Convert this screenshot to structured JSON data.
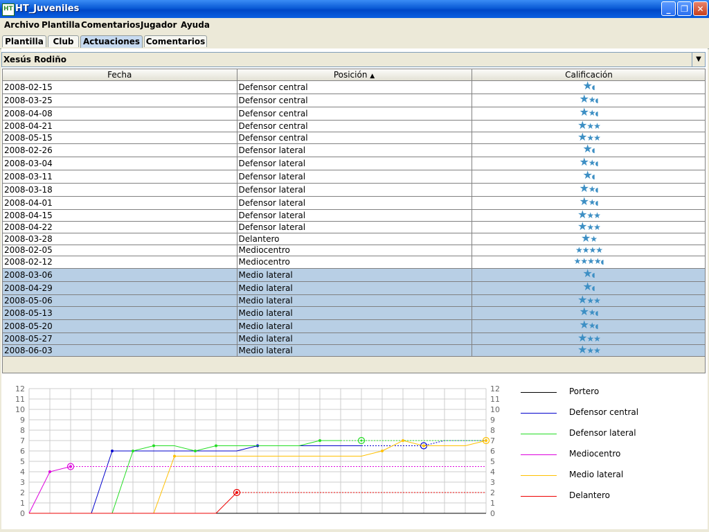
{
  "window": {
    "title": "HT_Juveniles",
    "icon_label": "HT"
  },
  "menu": [
    "Archivo",
    "Plantilla",
    "Comentarios",
    "Jugador",
    "Ayuda"
  ],
  "tabs": [
    {
      "label": "Plantilla",
      "active": false
    },
    {
      "label": "Club",
      "active": false
    },
    {
      "label": "Actuaciones",
      "active": true
    },
    {
      "label": "Comentarios",
      "active": false
    }
  ],
  "player_select": {
    "value": "Xesús Rodiño"
  },
  "table": {
    "columns": [
      "Fecha",
      "Posición",
      "Calificación"
    ],
    "sort_indicator": "▲",
    "rows": [
      {
        "fecha": "2008-02-15",
        "posicion": "Defensor central",
        "stars": "1.5",
        "selected": false
      },
      {
        "fecha": "2008-03-25",
        "posicion": "Defensor central",
        "stars": "2.5",
        "selected": false
      },
      {
        "fecha": "2008-04-08",
        "posicion": "Defensor central",
        "stars": "2.5",
        "selected": false
      },
      {
        "fecha": "2008-04-21",
        "posicion": "Defensor central",
        "stars": "3",
        "selected": false
      },
      {
        "fecha": "2008-05-15",
        "posicion": "Defensor central",
        "stars": "3",
        "selected": false
      },
      {
        "fecha": "2008-02-26",
        "posicion": "Defensor lateral",
        "stars": "1.5",
        "selected": false
      },
      {
        "fecha": "2008-03-04",
        "posicion": "Defensor lateral",
        "stars": "2.5",
        "selected": false
      },
      {
        "fecha": "2008-03-11",
        "posicion": "Defensor lateral",
        "stars": "1.5",
        "selected": false
      },
      {
        "fecha": "2008-03-18",
        "posicion": "Defensor lateral",
        "stars": "2.5",
        "selected": false
      },
      {
        "fecha": "2008-04-01",
        "posicion": "Defensor lateral",
        "stars": "2.5",
        "selected": false
      },
      {
        "fecha": "2008-04-15",
        "posicion": "Defensor lateral",
        "stars": "3",
        "selected": false
      },
      {
        "fecha": "2008-04-22",
        "posicion": "Defensor lateral",
        "stars": "3",
        "selected": false
      },
      {
        "fecha": "2008-03-28",
        "posicion": "Delantero",
        "stars": "2",
        "selected": false
      },
      {
        "fecha": "2008-02-05",
        "posicion": "Mediocentro",
        "stars": "4",
        "selected": false
      },
      {
        "fecha": "2008-02-12",
        "posicion": "Mediocentro",
        "stars": "4.5",
        "selected": false
      },
      {
        "fecha": "2008-03-06",
        "posicion": "Medio lateral",
        "stars": "1.5",
        "selected": true
      },
      {
        "fecha": "2008-04-29",
        "posicion": "Medio lateral",
        "stars": "1.5",
        "selected": true
      },
      {
        "fecha": "2008-05-06",
        "posicion": "Medio lateral",
        "stars": "3",
        "selected": true
      },
      {
        "fecha": "2008-05-13",
        "posicion": "Medio lateral",
        "stars": "2.5",
        "selected": true
      },
      {
        "fecha": "2008-05-20",
        "posicion": "Medio lateral",
        "stars": "2.5",
        "selected": true
      },
      {
        "fecha": "2008-05-27",
        "posicion": "Medio lateral",
        "stars": "3",
        "selected": true
      },
      {
        "fecha": "2008-06-03",
        "posicion": "Medio lateral",
        "stars": "3",
        "selected": true
      }
    ]
  },
  "chart_data": {
    "type": "line",
    "ylim": [
      0,
      12
    ],
    "yticks": [
      0,
      1,
      2,
      3,
      4,
      5,
      6,
      7,
      8,
      9,
      10,
      11,
      12
    ],
    "x_count": 23,
    "legend_position": "right",
    "grid": true,
    "series": [
      {
        "name": "Portero",
        "color": "#000000",
        "values": [
          0,
          0,
          0,
          0,
          0,
          0,
          0,
          0,
          0,
          0,
          0,
          0,
          0,
          0,
          0,
          0,
          0,
          0,
          0,
          0,
          0,
          0,
          0
        ],
        "end_marker": false
      },
      {
        "name": "Defensor central",
        "color": "#0000cc",
        "values": [
          0,
          0,
          0,
          0,
          6,
          6,
          6,
          6,
          6,
          6,
          6,
          6.5,
          6.5,
          6.5,
          6.5,
          6.5,
          6.5,
          6.5,
          6.5,
          6.5,
          7,
          7,
          7
        ],
        "solid_until": 16,
        "end_marker_index": 19
      },
      {
        "name": "Defensor lateral",
        "color": "#22dd22",
        "values": [
          0,
          0,
          0,
          0,
          0,
          6,
          6.5,
          6.5,
          6,
          6.5,
          6.5,
          6.5,
          6.5,
          6.5,
          7,
          7,
          7,
          7,
          7,
          7,
          7,
          7,
          7
        ],
        "solid_until": 15,
        "end_marker_index": 16
      },
      {
        "name": "Mediocentro",
        "color": "#dd00dd",
        "values": [
          0,
          4,
          4.5,
          4.5,
          4.5,
          4.5,
          4.5,
          4.5,
          4.5,
          4.5,
          4.5,
          4.5,
          4.5,
          4.5,
          4.5,
          4.5,
          4.5,
          4.5,
          4.5,
          4.5,
          4.5,
          4.5,
          4.5
        ],
        "solid_until": 2,
        "end_marker_index": 2
      },
      {
        "name": "Medio lateral",
        "color": "#ffc000",
        "values": [
          0,
          0,
          0,
          0,
          0,
          0,
          0,
          5.5,
          5.5,
          5.5,
          5.5,
          5.5,
          5.5,
          5.5,
          5.5,
          5.5,
          5.5,
          6,
          7,
          6.5,
          6.5,
          6.5,
          7
        ],
        "solid_until": 22,
        "end_marker_index": 22
      },
      {
        "name": "Delantero",
        "color": "#ee0000",
        "values": [
          0,
          0,
          0,
          0,
          0,
          0,
          0,
          0,
          0,
          0,
          2,
          2,
          2,
          2,
          2,
          2,
          2,
          2,
          2,
          2,
          2,
          2,
          2
        ],
        "solid_until": 10,
        "end_marker_index": 10
      }
    ]
  }
}
